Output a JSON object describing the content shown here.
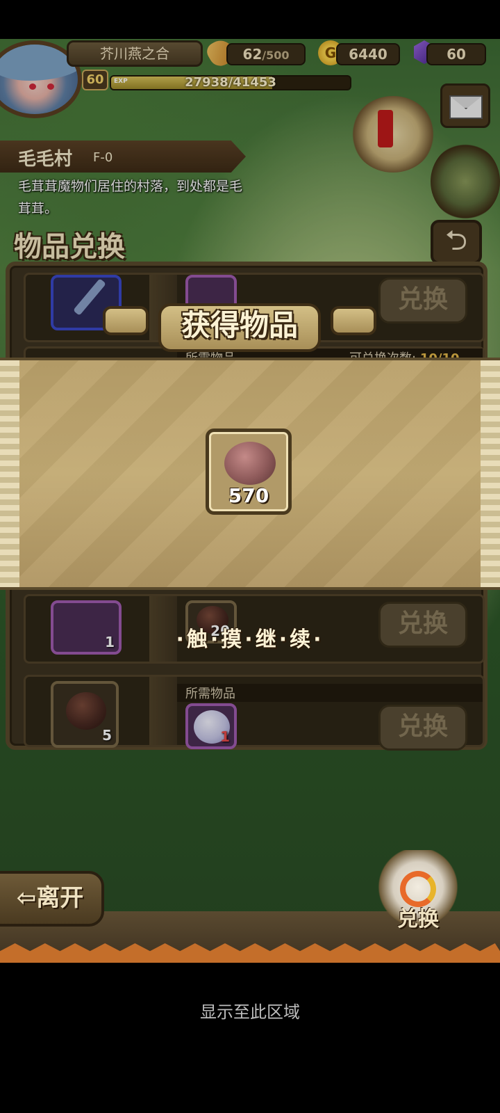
{
  "header": {
    "player_name": "芥川燕之合",
    "level": "60",
    "exp_label": "EXP",
    "exp_text": "27938/41453",
    "exp_fraction": 0.674,
    "stamina_value": "62",
    "stamina_max": "/500",
    "gold_icon_letter": "G",
    "gold": "6440",
    "gems": "60"
  },
  "location": {
    "name": "毛毛村",
    "code": "F-0",
    "description": "毛茸茸魔物们居住的村落，到处都是毛茸茸。"
  },
  "page": {
    "title": "物品兑换",
    "back_glyph": "⮌"
  },
  "exchange_list": {
    "required_label": "所需物品",
    "count_label": "可兑换次数:",
    "count_value": "10/10",
    "exchange_button": "兑换",
    "rows": [
      {
        "reward_qty": "",
        "cost_qty": ""
      },
      {
        "reward_qty": "",
        "cost_qty": ""
      },
      {
        "reward_qty": "1",
        "cost_qty": "20"
      },
      {
        "reward_qty": "5",
        "cost_qty": "1"
      }
    ]
  },
  "reward_popup": {
    "title": "获得物品",
    "item_qty": "570",
    "continue_text": "·触·摸·继·续·"
  },
  "footer": {
    "leave_button": "⇦离开",
    "exchange_button": "兑换"
  },
  "system": {
    "hint": "显示至此区域"
  }
}
